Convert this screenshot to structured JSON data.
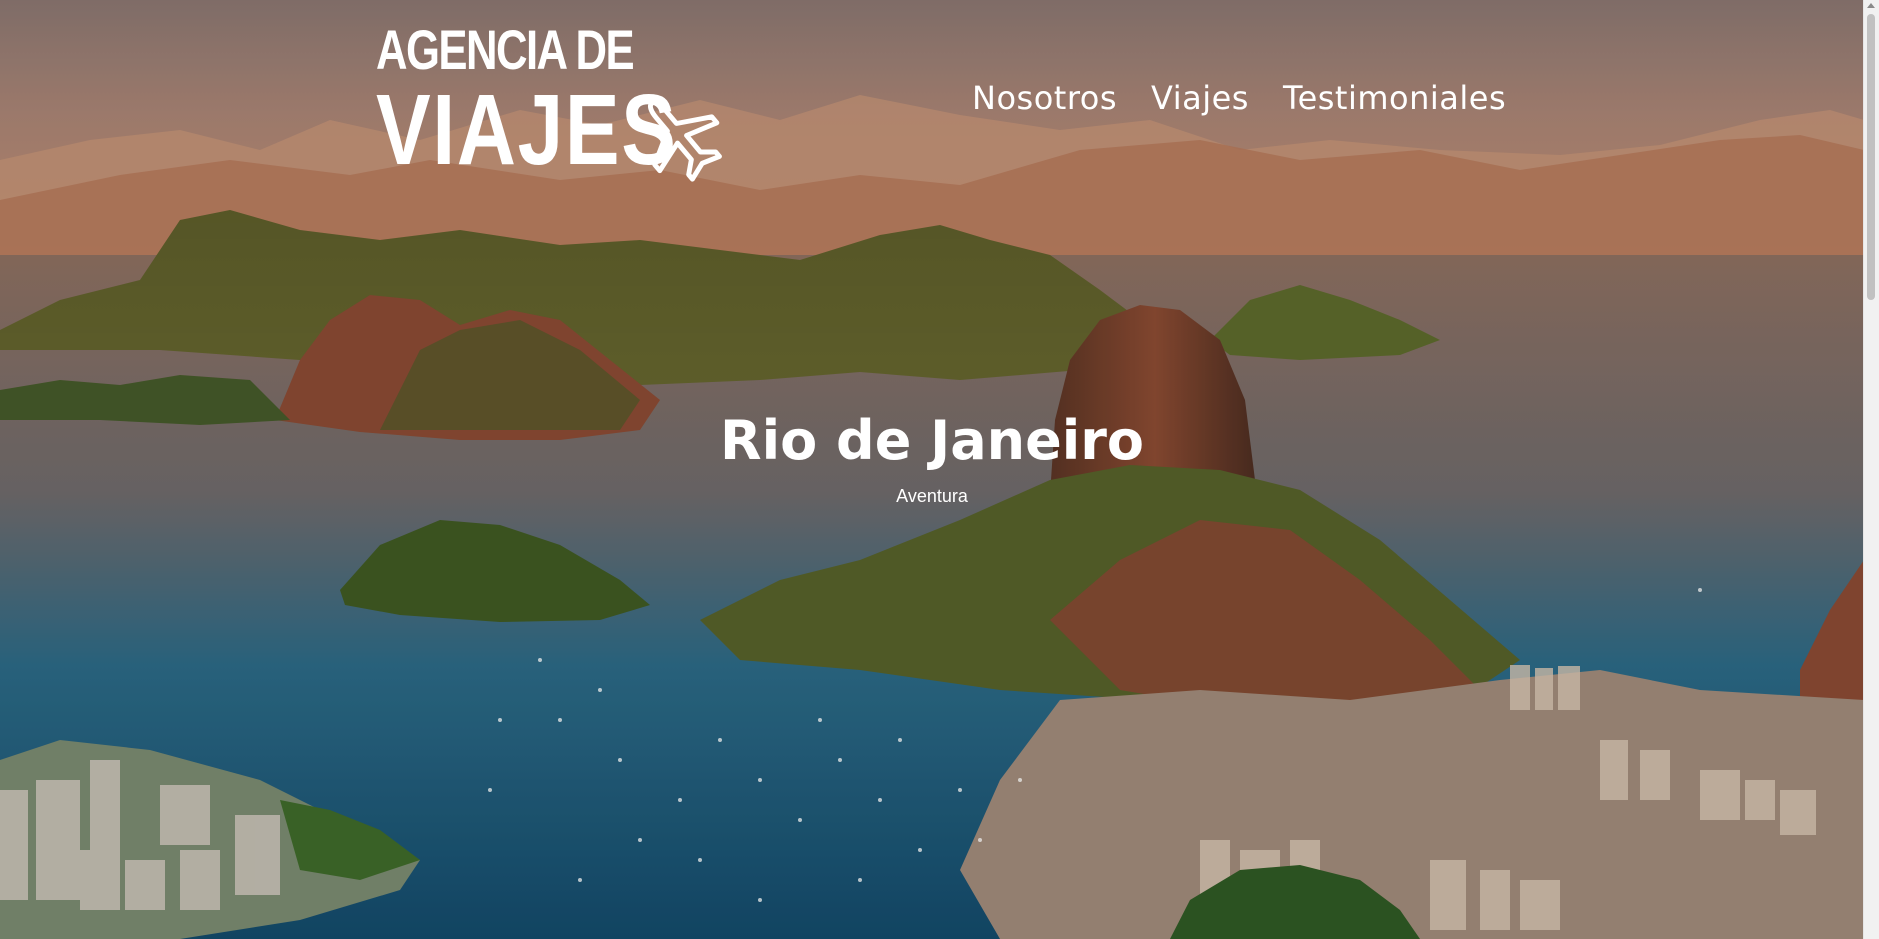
{
  "logo": {
    "line1": "AGENCIA DE",
    "line2": "VIAJES",
    "icon": "airplane-icon"
  },
  "nav": {
    "items": [
      {
        "label": "Nosotros"
      },
      {
        "label": "Viajes"
      },
      {
        "label": "Testimoniales"
      }
    ]
  },
  "hero": {
    "title": "Rio de Janeiro",
    "subtitle": "Aventura"
  },
  "colors": {
    "text": "#ffffff",
    "sky": "#b88a70",
    "water": "#1f5f80",
    "mountain": "#8a4a2a",
    "vegetation": "#4f6a2a"
  }
}
